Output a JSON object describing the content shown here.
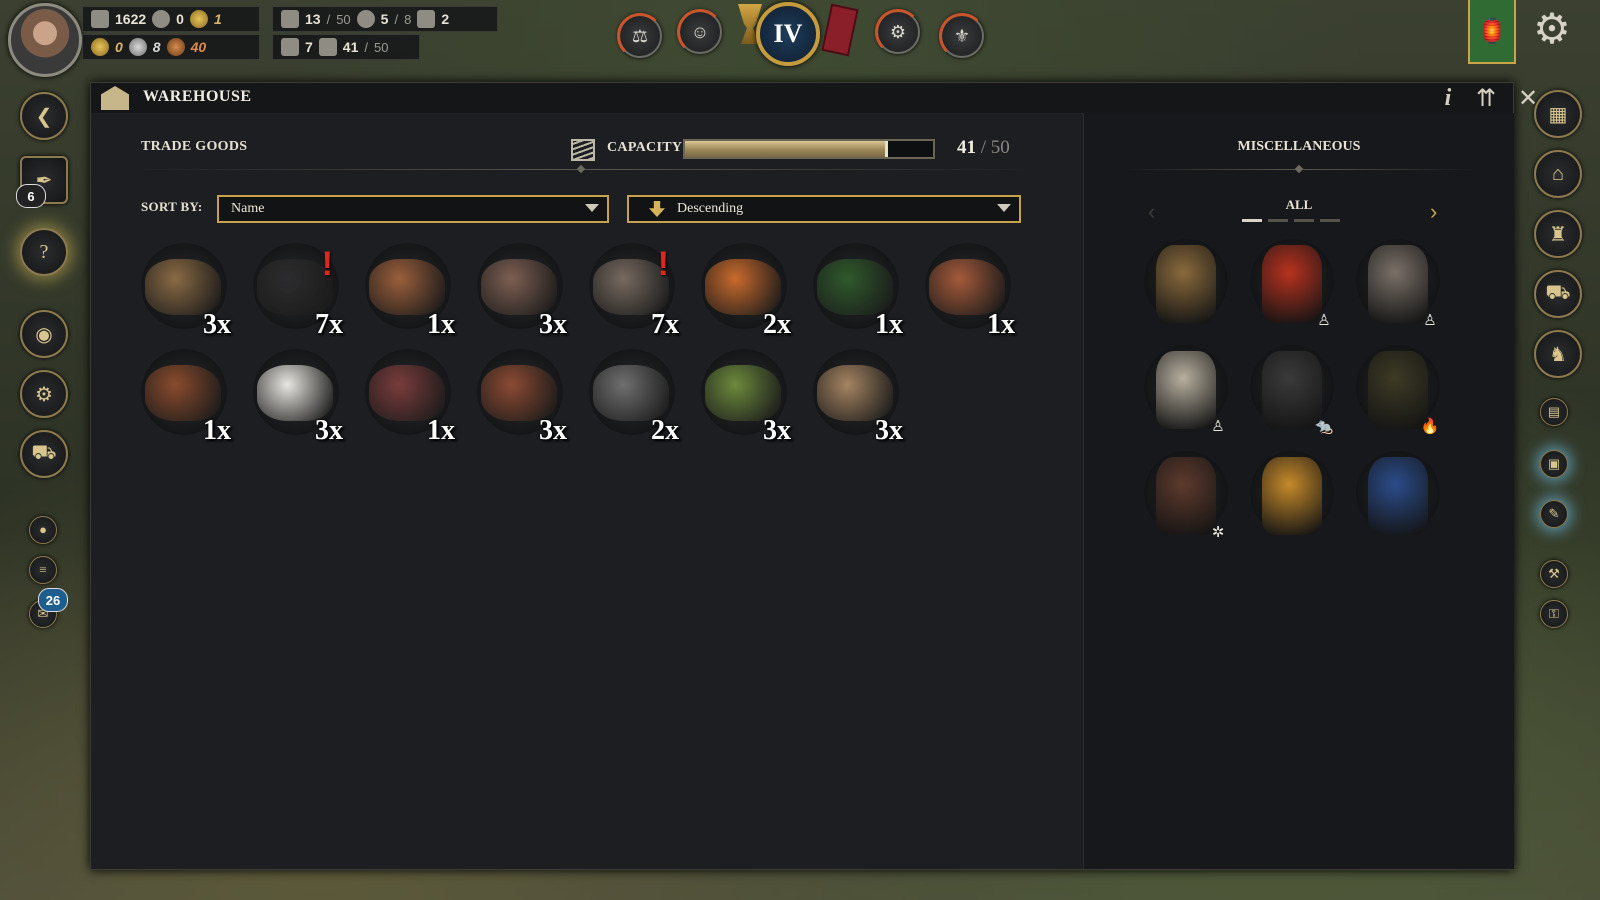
{
  "top_bar": {
    "resources_row1": {
      "faith": "1622",
      "dominance": "0",
      "crown": "1"
    },
    "resources_row2": {
      "gold": "0",
      "silver": "8",
      "copper": "40"
    },
    "population": {
      "current": "13",
      "sep": "/",
      "max": "50"
    },
    "buildings": {
      "current": "5",
      "sep": "/",
      "max": "8"
    },
    "carts": "2",
    "households": "7",
    "storage": {
      "current": "41",
      "sep": "/",
      "max": "50"
    },
    "era_label": "IV",
    "icons": [
      "justice-icon",
      "estates-icon",
      "goblet-icon",
      "era-emblem",
      "book-icon",
      "guild-icon",
      "fleur-de-lis-icon",
      "lantern-icon",
      "settings-gear-icon"
    ]
  },
  "left_rail": {
    "quests_badge": "6",
    "notifications_badge": "26"
  },
  "window": {
    "title": "WAREHOUSE",
    "info_label": "i",
    "close_label": "✕",
    "trade_goods": {
      "section_label": "TRADE GOODS",
      "capacity_label": "CAPACITY",
      "capacity_current": "41",
      "capacity_sep": "/",
      "capacity_max": "50",
      "capacity_fraction": 0.82,
      "sort_by_label": "SORT BY:",
      "sort_field": "Name",
      "sort_order": "Descending",
      "items": [
        {
          "name": "fur-pelt",
          "qty": "3x",
          "alert": false,
          "color": "#8a6a44"
        },
        {
          "name": "coal",
          "qty": "7x",
          "alert": true,
          "color": "#2c2c2e"
        },
        {
          "name": "copper-cookware",
          "qty": "1x",
          "alert": false,
          "color": "#9b5f3b"
        },
        {
          "name": "timber-planks",
          "qty": "3x",
          "alert": false,
          "color": "#7d5f52"
        },
        {
          "name": "iron-ore",
          "qty": "7x",
          "alert": true,
          "color": "#776a60"
        },
        {
          "name": "leather",
          "qty": "2x",
          "alert": false,
          "color": "#c96a2c"
        },
        {
          "name": "wine-bottle",
          "qty": "1x",
          "alert": false,
          "color": "#2f5a2c"
        },
        {
          "name": "pottery",
          "qty": "1x",
          "alert": false,
          "color": "#a55a3a"
        },
        {
          "name": "barrel-goods",
          "qty": "1x",
          "alert": false,
          "color": "#8a4b2d"
        },
        {
          "name": "wool",
          "qty": "3x",
          "alert": false,
          "color": "#e8e6e0"
        },
        {
          "name": "gems",
          "qty": "1x",
          "alert": false,
          "color": "#7a3c3c"
        },
        {
          "name": "ham",
          "qty": "3x",
          "alert": false,
          "color": "#8b4a32"
        },
        {
          "name": "yarn-spool",
          "qty": "2x",
          "alert": false,
          "color": "#6f6f6f"
        },
        {
          "name": "vegetables",
          "qty": "3x",
          "alert": false,
          "color": "#6c8a3c"
        },
        {
          "name": "logs",
          "qty": "3x",
          "alert": false,
          "color": "#a58461"
        }
      ]
    },
    "miscellaneous": {
      "section_label": "MISCELLANEOUS",
      "tab_label": "ALL",
      "pages": 4,
      "active_page": 1,
      "items": [
        {
          "name": "plague-mask",
          "tag": "",
          "color": "#8a6a3c"
        },
        {
          "name": "red-tunic",
          "tag": "person-icon",
          "color": "#b8321f"
        },
        {
          "name": "chainmail",
          "tag": "person-icon",
          "color": "#7a7068"
        },
        {
          "name": "linen-shirt",
          "tag": "person-icon",
          "color": "#b8b0a0"
        },
        {
          "name": "cauldron",
          "tag": "rat-icon",
          "color": "#3a3a3a"
        },
        {
          "name": "oil-flask",
          "tag": "fire-icon",
          "color": "#3d3a24"
        },
        {
          "name": "saw-blade",
          "tag": "wheel-icon",
          "color": "#5e3a2c"
        },
        {
          "name": "spice-sack",
          "tag": "",
          "color": "#c68a2a"
        },
        {
          "name": "heraldic-banner",
          "tag": "",
          "color": "#2b4c8a"
        }
      ]
    }
  }
}
